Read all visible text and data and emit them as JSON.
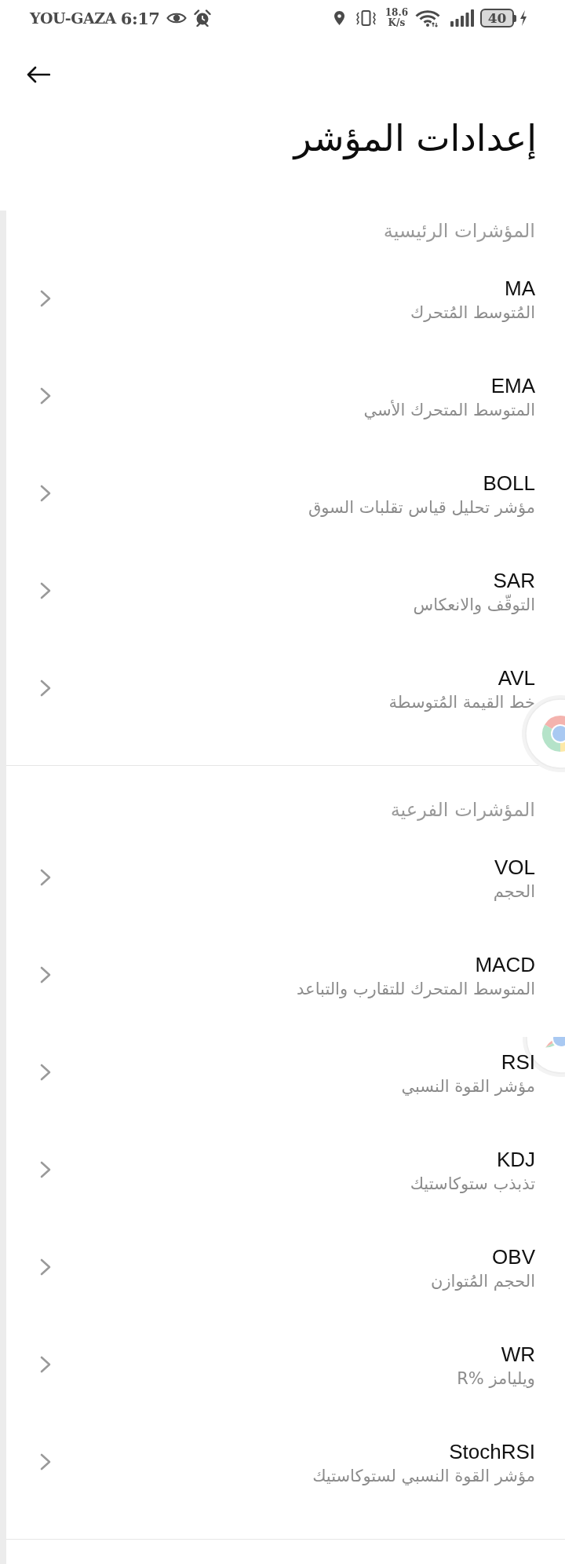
{
  "status_bar": {
    "carrier": "YOU-GAZA",
    "time": "6:17",
    "network_speed": "18.6",
    "network_speed_unit": "K/s",
    "battery": "40"
  },
  "header": {
    "title": "إعدادات المؤشر"
  },
  "sections": [
    {
      "title": "المؤشرات الرئيسية",
      "items": [
        {
          "name": "MA",
          "description": "المُتوسط المُتحرك"
        },
        {
          "name": "EMA",
          "description": "المتوسط المتحرك الأسي"
        },
        {
          "name": "BOLL",
          "description": "مؤشر تحليل قياس تقلبات السوق"
        },
        {
          "name": "SAR",
          "description": "التوقّف والانعكاس"
        },
        {
          "name": "AVL",
          "description": "خط القيمة المُتوسطة"
        }
      ]
    },
    {
      "title": "المؤشرات الفرعية",
      "items": [
        {
          "name": "VOL",
          "description": "الحجم"
        },
        {
          "name": "MACD",
          "description": "المتوسط المتحرك للتقارب والتباعد"
        },
        {
          "name": "RSI",
          "description": "مؤشر القوة النسبي"
        },
        {
          "name": "KDJ",
          "description": "تذبذب ستوكاستيك"
        },
        {
          "name": "OBV",
          "description": "الحجم المُتوازن"
        },
        {
          "name": "WR",
          "description": "ويليامز %R"
        },
        {
          "name": "StochRSI",
          "description": "مؤشر القوة النسبي لستوكاستيك"
        }
      ]
    }
  ]
}
